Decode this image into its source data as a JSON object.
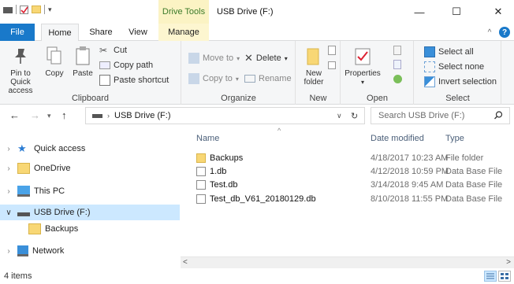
{
  "titlebar": {
    "context_tab": "Drive Tools",
    "title": "USB Drive (F:)",
    "minimize": "—",
    "maximize": "☐",
    "close": "✕"
  },
  "ribbon_tabs": {
    "file": "File",
    "home": "Home",
    "share": "Share",
    "view": "View",
    "manage": "Manage",
    "collapse": "^",
    "help": "?"
  },
  "ribbon": {
    "clipboard": {
      "label": "Clipboard",
      "pin_line1": "Pin to Quick",
      "pin_line2": "access",
      "copy": "Copy",
      "paste": "Paste",
      "cut": "Cut",
      "copy_path": "Copy path",
      "paste_shortcut": "Paste shortcut"
    },
    "organize": {
      "label": "Organize",
      "move_to": "Move to",
      "copy_to": "Copy to",
      "delete": "Delete",
      "rename": "Rename"
    },
    "new": {
      "label": "New",
      "new_folder_line1": "New",
      "new_folder_line2": "folder"
    },
    "open": {
      "label": "Open",
      "properties": "Properties"
    },
    "select": {
      "label": "Select",
      "select_all": "Select all",
      "select_none": "Select none",
      "invert": "Invert selection"
    }
  },
  "address": {
    "path": "USB Drive (F:)",
    "search_placeholder": "Search USB Drive (F:)"
  },
  "nav": [
    {
      "label": "Quick access",
      "icon": "star-icon"
    },
    {
      "label": "OneDrive",
      "icon": "folder-icon"
    },
    {
      "label": "This PC",
      "icon": "monitor-icon"
    },
    {
      "label": "USB Drive (F:)",
      "icon": "drive-icon"
    },
    {
      "label": "Backups",
      "icon": "folder-icon"
    },
    {
      "label": "Network",
      "icon": "network-icon"
    }
  ],
  "columns": {
    "name": "Name",
    "date": "Date modified",
    "type": "Type"
  },
  "files": [
    {
      "name": "Backups",
      "date": "4/18/2017 10:23 AM",
      "type": "File folder",
      "icon": "folder-icon"
    },
    {
      "name": "1.db",
      "date": "4/12/2018 10:59 PM",
      "type": "Data Base File",
      "icon": "db-file-icon"
    },
    {
      "name": "Test.db",
      "date": "3/14/2018 9:45 AM",
      "type": "Data Base File",
      "icon": "db-file-icon"
    },
    {
      "name": "Test_db_V61_20180129.db",
      "date": "8/10/2018 11:55 PM",
      "type": "Data Base File",
      "icon": "db-file-icon"
    }
  ],
  "status": {
    "items": "4 items"
  },
  "colors": {
    "file_tab": "#1979ca",
    "context_tab": "#fbf3c4",
    "selected": "#cce8ff",
    "folder": "#f8d775"
  }
}
